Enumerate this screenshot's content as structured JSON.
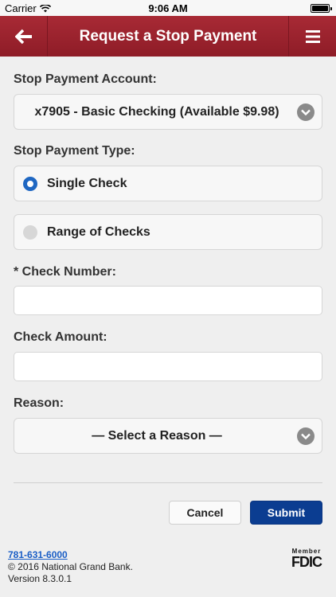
{
  "status_bar": {
    "carrier": "Carrier",
    "time": "9:06 AM"
  },
  "nav": {
    "title": "Request a Stop Payment",
    "back_icon": "arrow-left-icon",
    "menu_icon": "hamburger-menu-icon"
  },
  "form": {
    "account_label": "Stop Payment Account:",
    "account_value": "x7905 - Basic Checking (Available $9.98)",
    "type_label": "Stop Payment Type:",
    "type_options": [
      {
        "label": "Single Check",
        "selected": true
      },
      {
        "label": "Range of Checks",
        "selected": false
      }
    ],
    "check_number_label": "* Check Number:",
    "check_number_value": "",
    "check_amount_label": "Check Amount:",
    "check_amount_value": "",
    "reason_label": "Reason:",
    "reason_value": "— Select a Reason —"
  },
  "actions": {
    "cancel": "Cancel",
    "submit": "Submit"
  },
  "footer": {
    "phone": "781-631-6000",
    "copyright": "© 2016 National Grand Bank.",
    "version": "Version 8.3.0.1",
    "fdic_member": "Member",
    "fdic_mark": "FDIC"
  },
  "colors": {
    "nav_background": "#9a2330",
    "submit_background": "#0b3d91",
    "radio_selected": "#1f67c2"
  }
}
